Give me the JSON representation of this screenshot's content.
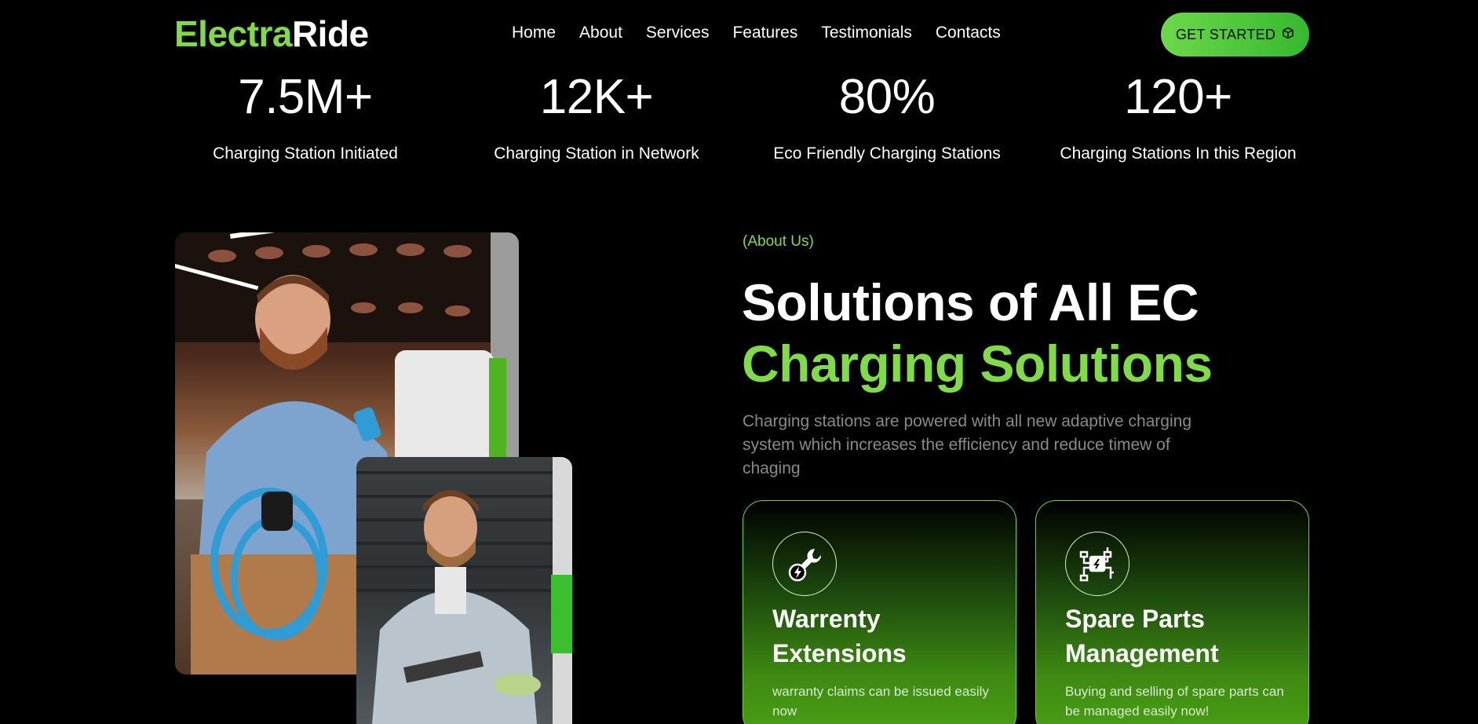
{
  "brand": {
    "part1": "Electra",
    "part2": "Ride"
  },
  "nav": [
    "Home",
    "About",
    "Services",
    "Features",
    "Testimonials",
    "Contacts"
  ],
  "cta": {
    "label": "GET STARTED",
    "icon": "cube-icon"
  },
  "stats": [
    {
      "value": "7.5M+",
      "label": "Charging Station Initiated"
    },
    {
      "value": "12K+",
      "label": "Charging Station in Network"
    },
    {
      "value": "80%",
      "label": "Eco Friendly Charging Stations"
    },
    {
      "value": "120+",
      "label": "Charging Stations In this Region"
    }
  ],
  "about": {
    "eyebrow": "(About Us)",
    "title_line1": "Solutions of All EC",
    "title_line2": "Charging Solutions",
    "description": "Charging stations are powered with all new adaptive charging system which increases the efficiency and reduce timew of chaging"
  },
  "cards": [
    {
      "icon": "wrench-bolt-icon",
      "title": "Warrenty Extensions",
      "text": "warranty claims can be issued easily now"
    },
    {
      "icon": "plug-parts-icon",
      "title": "Spare Parts Management",
      "text": "Buying and selling of spare parts can be managed easily now!"
    }
  ],
  "colors": {
    "accent": "#7fdc46",
    "background": "#000000",
    "cta_gradient_start": "#6bd94a",
    "cta_gradient_end": "#36b82e"
  }
}
